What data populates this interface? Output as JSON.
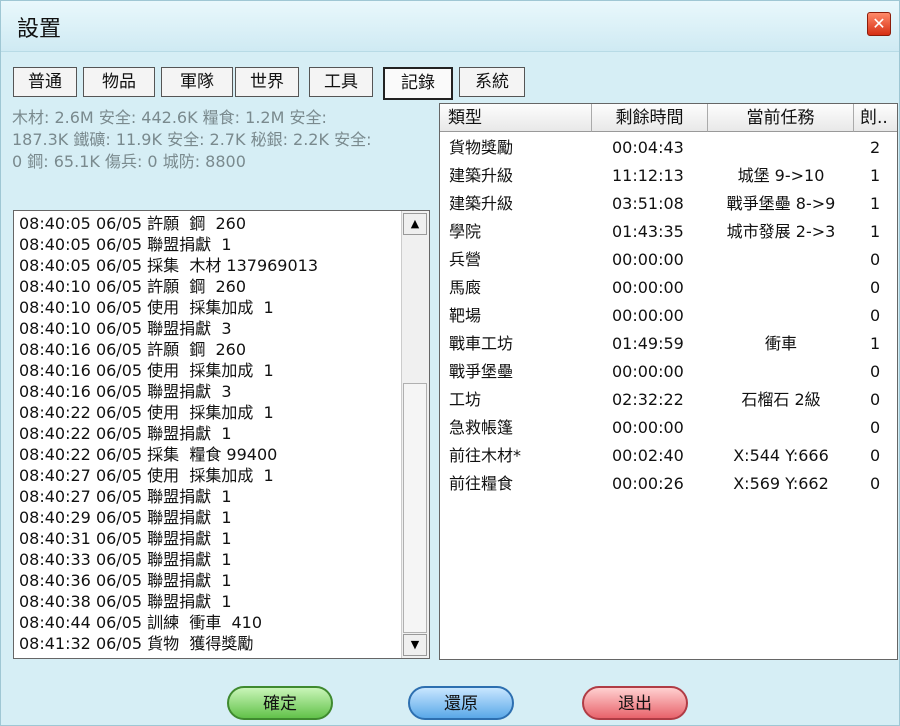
{
  "window": {
    "title": "設置"
  },
  "tabs": [
    "普通",
    "物品",
    "軍隊",
    "世界",
    "工具",
    "記錄",
    "系統"
  ],
  "active_tab": "記錄",
  "resources_lines": [
    "木材: 2.6M 安全: 442.6K  糧食: 1.2M 安全:",
    "187.3K  鐵礦: 11.9K 安全: 2.7K  秘銀: 2.2K 安全:",
    "0  鋼: 65.1K  傷兵: 0  城防: 8800"
  ],
  "log": [
    "08:40:05 06/05 許願  鋼  260",
    "08:40:05 06/05 聯盟捐獻  1",
    "08:40:05 06/05 採集  木材 137969013",
    "08:40:10 06/05 許願  鋼  260",
    "08:40:10 06/05 使用  採集加成  1",
    "08:40:10 06/05 聯盟捐獻  3",
    "08:40:16 06/05 許願  鋼  260",
    "08:40:16 06/05 使用  採集加成  1",
    "08:40:16 06/05 聯盟捐獻  3",
    "08:40:22 06/05 使用  採集加成  1",
    "08:40:22 06/05 聯盟捐獻  1",
    "08:40:22 06/05 採集  糧食 99400",
    "08:40:27 06/05 使用  採集加成  1",
    "08:40:27 06/05 聯盟捐獻  1",
    "08:40:29 06/05 聯盟捐獻  1",
    "08:40:31 06/05 聯盟捐獻  1",
    "08:40:33 06/05 聯盟捐獻  1",
    "08:40:36 06/05 聯盟捐獻  1",
    "08:40:38 06/05 聯盟捐獻  1",
    "08:40:44 06/05 訓練  衝車  410",
    "08:41:32 06/05 貨物  獲得獎勵"
  ],
  "table": {
    "columns": [
      "類型",
      "剩餘時間",
      "當前任務",
      "剆.."
    ],
    "rows": [
      [
        "貨物獎勵",
        "00:04:43",
        "",
        "2"
      ],
      [
        "建築升級",
        "11:12:13",
        "城堡 9->10",
        "1"
      ],
      [
        "建築升級",
        "03:51:08",
        "戰爭堡壘 8->9",
        "1"
      ],
      [
        "學院",
        "01:43:35",
        "城市發展 2->3",
        "1"
      ],
      [
        "兵營",
        "00:00:00",
        "",
        "0"
      ],
      [
        "馬廄",
        "00:00:00",
        "",
        "0"
      ],
      [
        "靶場",
        "00:00:00",
        "",
        "0"
      ],
      [
        "戰車工坊",
        "01:49:59",
        "衝車",
        "1"
      ],
      [
        "戰爭堡壘",
        "00:00:00",
        "",
        "0"
      ],
      [
        "工坊",
        "02:32:22",
        "石榴石 2級",
        "0"
      ],
      [
        "急救帳篷",
        "00:00:00",
        "",
        "0"
      ],
      [
        "前往木材*",
        "00:02:40",
        "X:544 Y:666",
        "0"
      ],
      [
        "前往糧食",
        "00:00:26",
        "X:569 Y:662",
        "0"
      ]
    ]
  },
  "buttons": {
    "ok": "確定",
    "reset": "還原",
    "exit": "退出"
  },
  "icons": {
    "close": "close-icon",
    "scroll_up": "arrow-up-icon",
    "scroll_down": "arrow-down-icon"
  }
}
